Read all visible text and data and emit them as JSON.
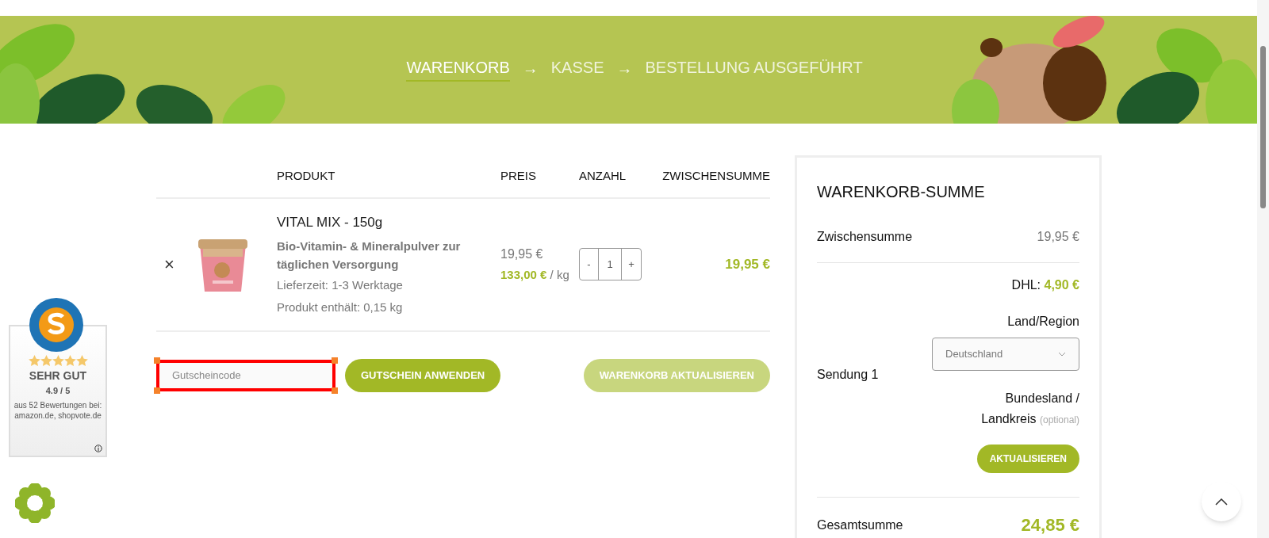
{
  "steps": [
    {
      "label": "WARENKORB",
      "selected": true
    },
    {
      "label": "KASSE",
      "selected": false
    },
    {
      "label": "BESTELLUNG AUSGEFÜHRT",
      "selected": false
    }
  ],
  "step_separator": "→",
  "cart": {
    "columns": [
      "PRODUKT",
      "PREIS",
      "ANZAHL",
      "ZWISCHENSUMME"
    ],
    "rows": [
      {
        "remove": "×",
        "name": "VITAL MIX - 150g",
        "subtitle": "Bio-Vitamin- & Mineralpulver zur täglichen Versorgung",
        "delivery": "Lieferzeit: 1-3 Werktage",
        "contents": "Produkt enthält: 0,15 kg",
        "price": "19,95 €",
        "unit_price": "133,00 €",
        "unit": " / kg",
        "minus": "-",
        "quantity": "1",
        "plus": "+",
        "subtotal": "19,95 €"
      }
    ],
    "coupon": {
      "placeholder": "Gutscheincode",
      "highlighted": true
    },
    "apply_button": {
      "label": "GUTSCHEIN ANWENDEN",
      "disabled": false
    },
    "update_button": {
      "label": "WARENKORB AKTUALISIEREN",
      "disabled": true
    }
  },
  "totals": {
    "title": "WARENKORB-SUMME",
    "subtotal_label": "Zwischensumme",
    "subtotal": "19,95 €",
    "shipping_label": "Sendung 1",
    "carrier": "DHL:",
    "shipping_price": "4,90 €",
    "country_label": "Land/Region",
    "country": "Deutschland",
    "state_label": "Bundesland / Landkreis",
    "state_hint": "(optional)",
    "update_button": "AKTUALISIEREN",
    "total_label": "Gesamtsumme",
    "total": "24,85 €"
  },
  "rating_widget": {
    "stars": 5,
    "verdict": "SEHR GUT",
    "score": "4.9 / 5",
    "source": "aus 52 Bewertungen bei: amazon.de, shopvote.de"
  }
}
